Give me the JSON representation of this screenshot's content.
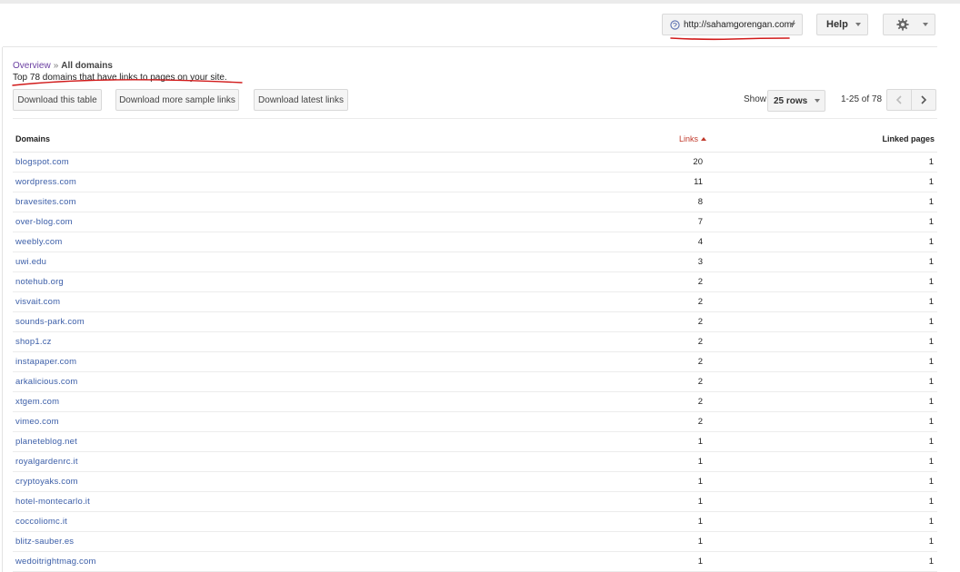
{
  "header": {
    "site_url": "http://sahamgorengan.com/",
    "help_label": "Help"
  },
  "breadcrumb": {
    "overview": "Overview",
    "separator": "»",
    "current": "All domains"
  },
  "description": "Top 78 domains that have links to pages on your site.",
  "toolbar": {
    "download_table": "Download this table",
    "download_sample": "Download more sample links",
    "download_latest": "Download latest links",
    "show_label": "Show",
    "rows_value": "25 rows",
    "range": "1-25 of 78"
  },
  "table": {
    "columns": [
      "Domains",
      "Links",
      "Linked pages"
    ],
    "rows": [
      {
        "domain": "blogspot.com",
        "links": "20",
        "pages": "1"
      },
      {
        "domain": "wordpress.com",
        "links": "11",
        "pages": "1"
      },
      {
        "domain": "bravesites.com",
        "links": "8",
        "pages": "1"
      },
      {
        "domain": "over-blog.com",
        "links": "7",
        "pages": "1"
      },
      {
        "domain": "weebly.com",
        "links": "4",
        "pages": "1"
      },
      {
        "domain": "uwi.edu",
        "links": "3",
        "pages": "1"
      },
      {
        "domain": "notehub.org",
        "links": "2",
        "pages": "1"
      },
      {
        "domain": "visvait.com",
        "links": "2",
        "pages": "1"
      },
      {
        "domain": "sounds-park.com",
        "links": "2",
        "pages": "1"
      },
      {
        "domain": "shop1.cz",
        "links": "2",
        "pages": "1"
      },
      {
        "domain": "instapaper.com",
        "links": "2",
        "pages": "1"
      },
      {
        "domain": "arkalicious.com",
        "links": "2",
        "pages": "1"
      },
      {
        "domain": "xtgem.com",
        "links": "2",
        "pages": "1"
      },
      {
        "domain": "vimeo.com",
        "links": "2",
        "pages": "1"
      },
      {
        "domain": "planeteblog.net",
        "links": "1",
        "pages": "1"
      },
      {
        "domain": "royalgardenrc.it",
        "links": "1",
        "pages": "1"
      },
      {
        "domain": "cryptoyaks.com",
        "links": "1",
        "pages": "1"
      },
      {
        "domain": "hotel-montecarlo.it",
        "links": "1",
        "pages": "1"
      },
      {
        "domain": "coccoliomc.it",
        "links": "1",
        "pages": "1"
      },
      {
        "domain": "blitz-sauber.es",
        "links": "1",
        "pages": "1"
      },
      {
        "domain": "wedoitrightmag.com",
        "links": "1",
        "pages": "1"
      }
    ]
  },
  "colors": {
    "link": "#3b5ea8",
    "visited": "#6a3ea1",
    "sort_active": "#c0392b",
    "annotation": "#d11a1a"
  }
}
